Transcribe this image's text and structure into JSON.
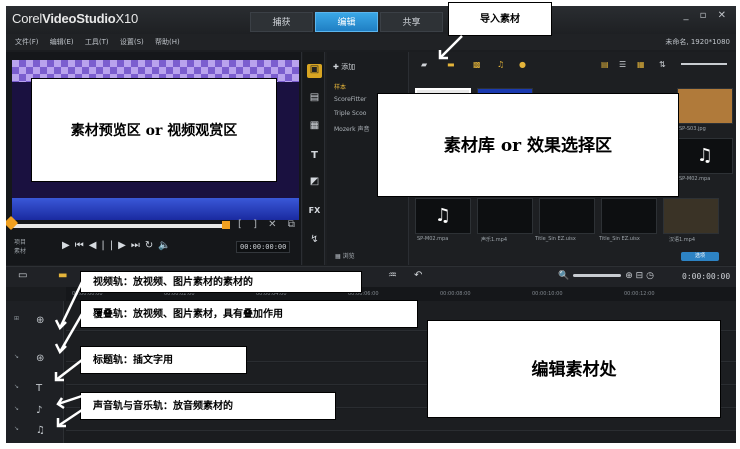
{
  "app": {
    "brand_prefix": "Corel",
    "brand_main": "VideoStudio",
    "brand_version": "X10",
    "window_controls": "_ ▫ ✕"
  },
  "tabs": [
    {
      "label": "捕获",
      "active": false
    },
    {
      "label": "编辑",
      "active": true
    },
    {
      "label": "共享",
      "active": false
    }
  ],
  "menu": [
    "文件(F)",
    "编辑(E)",
    "工具(T)",
    "设置(S)",
    "帮助(H)"
  ],
  "project_info": "未命名, 1920*1080",
  "preview": {
    "label_project": "项目",
    "label_clip": "素材",
    "timecode": "00:00:00:00"
  },
  "library": {
    "add_label": "添加",
    "tree_items": [
      "样本",
      "ScoreFitter",
      "Triple Scoo",
      "Mozerk 声音"
    ],
    "browse_label": "浏览",
    "captions": [
      "SP-S03.jpg",
      "SP-M02.mpa",
      "SP-M02.mpa",
      "声乐1.mp4",
      "Title_Sin EZ.uisx",
      "Title_Sin EZ.uisx",
      "汉语1.mp4"
    ],
    "bottom_button": "选项"
  },
  "timeline": {
    "time": "0:00:00:00",
    "ruler": [
      "00:00:00:00",
      "00:00:02:00",
      "00:00:04:00",
      "00:00:06:00",
      "00:00:08:00",
      "00:00:10:00",
      "00:00:12:00"
    ]
  },
  "annotations": {
    "import": "导入素材",
    "preview_area": "素材预览区 or 视频观赏区",
    "library_area": "素材库 or 效果选择区",
    "video_track": "视频轨：放视频、图片素材的素材的",
    "overlay_track": "覆叠轨：放视频、图片素材，具有叠加作用",
    "title_track": "标题轨：插文字用",
    "audio_track": "声音轨与音乐轨：放音频素材的",
    "edit_area": "编辑素材处"
  },
  "colors": {
    "accent_blue": "#1f7fc4",
    "accent_gold": "#d8a522",
    "timeline_playhead": "#f0a020"
  }
}
